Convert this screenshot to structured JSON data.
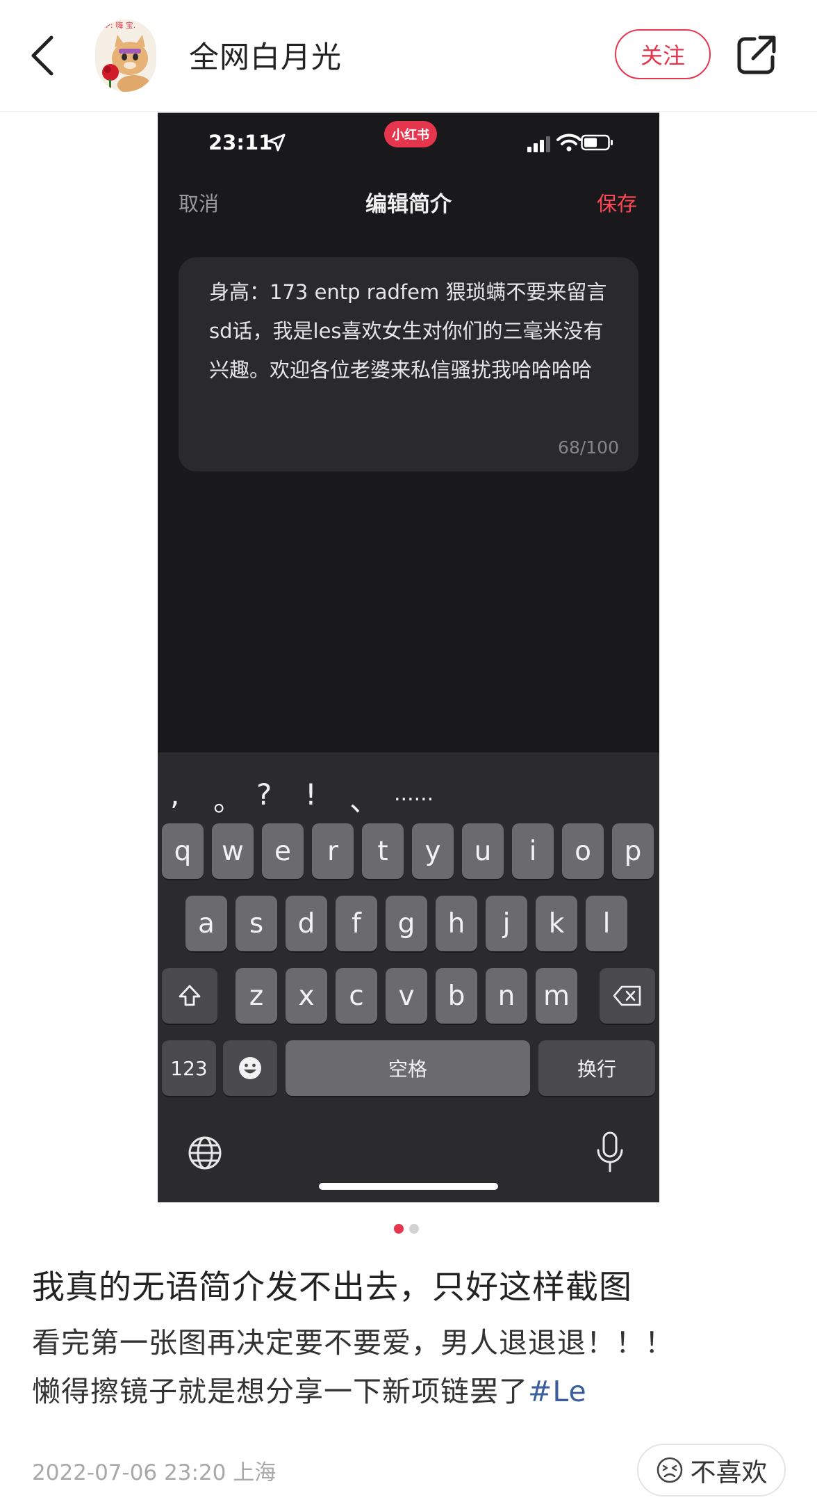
{
  "header": {
    "author_name": "全网白月光",
    "follow_label": "关注",
    "avatar_caption": "ntP: 嗨 宝."
  },
  "screenshot": {
    "status_bar": {
      "time": "23:11",
      "app_badge": "小红书"
    },
    "nav": {
      "cancel": "取消",
      "title": "编辑简介",
      "save": "保存"
    },
    "bio": {
      "text": "身高：173 entp radfem 猥琐螨不要来留言sd话，我是les喜欢女生对你们的三毫米没有兴趣。欢迎各位老婆来私信骚扰我哈哈哈哈",
      "counter": "68/100"
    },
    "keyboard": {
      "punctuation": [
        ",",
        "。",
        "?",
        "!",
        "、",
        "......"
      ],
      "row1": [
        "q",
        "w",
        "e",
        "r",
        "t",
        "y",
        "u",
        "i",
        "o",
        "p"
      ],
      "row2": [
        "a",
        "s",
        "d",
        "f",
        "g",
        "h",
        "j",
        "k",
        "l"
      ],
      "row3": [
        "z",
        "x",
        "c",
        "v",
        "b",
        "n",
        "m"
      ],
      "numbers_key": "123",
      "space_key": "空格",
      "return_key": "换行"
    }
  },
  "carousel": {
    "current_index": 1,
    "total": 2
  },
  "post": {
    "title": "我真的无语简介发不出去，只好这样截图",
    "body_line1": "看完第一张图再决定要不要爱，男人退退退！！！",
    "body_line2": "懒得擦镜子就是想分享一下新项链罢了",
    "tag": "#Le",
    "date": "2022-07-06 23:20",
    "location": "上海",
    "dislike_label": "不喜欢"
  },
  "colors": {
    "accent": "#e5364d",
    "save_red": "#ff4656",
    "tag_blue": "#3a5f9c"
  }
}
